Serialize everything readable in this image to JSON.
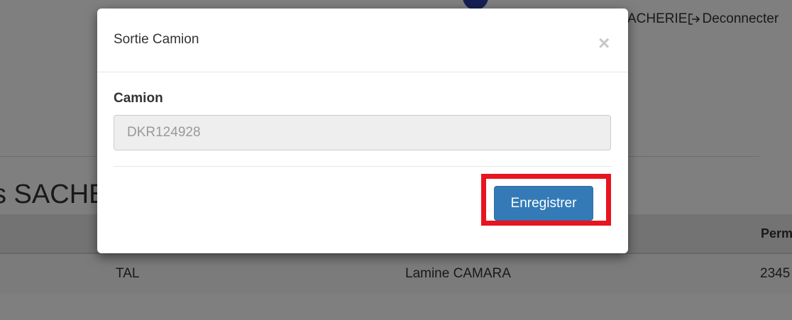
{
  "header": {
    "user_label": "ACHERIE",
    "logout_label": "Deconnecter"
  },
  "page": {
    "heading": "s SACHE"
  },
  "table": {
    "columns": [
      "Perm"
    ],
    "rows": [
      [
        "TAL",
        "Lamine CAMARA",
        "2345"
      ]
    ]
  },
  "modal": {
    "title": "Sortie Camion",
    "close_glyph": "×",
    "field_label": "Camion",
    "field_value": "DKR124928",
    "save_label": "Enregistrer"
  },
  "colors": {
    "primary": "#337ab7",
    "highlight": "#e8141f"
  },
  "icons": {
    "logout": "logout-icon",
    "close": "close-icon"
  }
}
